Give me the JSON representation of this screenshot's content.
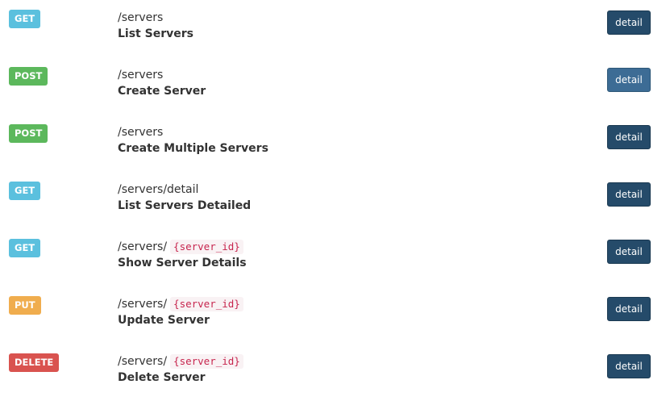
{
  "endpoints": [
    {
      "method": "GET",
      "path": "/servers",
      "param": "",
      "title": "List Servers",
      "button": "detail"
    },
    {
      "method": "POST",
      "path": "/servers",
      "param": "",
      "title": "Create Server",
      "button": "detail"
    },
    {
      "method": "POST",
      "path": "/servers",
      "param": "",
      "title": "Create Multiple Servers",
      "button": "detail"
    },
    {
      "method": "GET",
      "path": "/servers/detail",
      "param": "",
      "title": "List Servers Detailed",
      "button": "detail"
    },
    {
      "method": "GET",
      "path": "/servers/",
      "param": "{server_id}",
      "title": "Show Server Details",
      "button": "detail"
    },
    {
      "method": "PUT",
      "path": "/servers/",
      "param": "{server_id}",
      "title": "Update Server",
      "button": "detail"
    },
    {
      "method": "DELETE",
      "path": "/servers/",
      "param": "{server_id}",
      "title": "Delete Server",
      "button": "detail"
    }
  ],
  "colors": {
    "get": "#5bc0de",
    "post": "#5cb85c",
    "put": "#f0ad4e",
    "delete": "#d9534f",
    "detail_button": "#254b6a",
    "detail_button_hover": "#3d6c95",
    "param_text": "#c7254e"
  }
}
